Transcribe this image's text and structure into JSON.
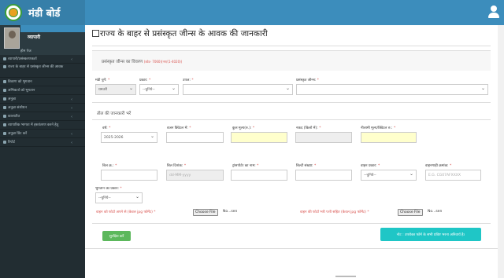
{
  "header": {
    "app_title": "मंडी बोर्ड"
  },
  "sidebar": {
    "user_name": "व्यापारी",
    "home_link": "होम पेज",
    "items": [
      {
        "label": "व्यापारी/प्रसंस्करणकर्ता"
      },
      {
        "label": "राज्य के बाहर से प्रसंस्कृत जीन्स की आवक"
      },
      {
        "label": "विवरण को भुगतान"
      },
      {
        "label": "अभिकर्ता को भुगतान"
      },
      {
        "label": "अनुज्ञा"
      },
      {
        "label": "अनुज्ञा संशोधन"
      },
      {
        "label": "कालातीत"
      },
      {
        "label": "व्यापारिक भागता में हस्तांतरण करने हेतु"
      },
      {
        "label": "अनुज्ञा प्रिंट करें"
      },
      {
        "label": "रिपोर्ट"
      }
    ]
  },
  "page": {
    "title": "राज्य के बाहर से प्रसंस्कृत जीन्स के आवक की जानकारी"
  },
  "panel": {
    "title": "प्रसंस्कृत जीन्स का विवरण",
    "hint": "(कोड- 7060)(नग/(1-4020))"
  },
  "row1": {
    "mandi_label": "मंडी चुनें:",
    "mandi_value": "धमतरी",
    "prakar_label": "प्रकार:",
    "prakar_value": "--चुनिये--",
    "upaj_label": "उपज:",
    "upaj_value": "",
    "jeans_label": "प्रसंस्कृत जीन्स:",
    "jeans_value": ""
  },
  "section": {
    "title": "तौल की जानकारी भरें"
  },
  "row2": {
    "year_label": "वर्ष:",
    "year_value": "2025-2026",
    "weight_label": "वजन क्विंटल में:",
    "price_label": "कुल मूल्य(रु.):",
    "cash_label": "नकद (किलो में):",
    "auction_label": "नीलामी मूल्य/क्विंटल रु.:"
  },
  "row3": {
    "bill_label": "बिल क्र.:",
    "bill_date_label": "बिल दिनांक:",
    "bill_date_placeholder": "dd-MM-yyyy",
    "transporter_label": "ट्रांसपोर्टर का नाम:",
    "builty_label": "बिल्टी संख्या:",
    "vehicle_type_label": "वाहन प्रकार:",
    "vehicle_type_value": "--चुनिये--",
    "vehicle_no_label": "वाहनगाड़ी क्रमांक:",
    "vehicle_no_placeholder": "E.G. CG07AFXXXX"
  },
  "row4": {
    "payment_label": "भुगतान का प्रकार:",
    "payment_value": "--चुनिये--"
  },
  "uploads": {
    "doc1_label": "वाहन को फोटो अपने से (केवल jpg फॉर्मेट)",
    "doc2_label": "वाहन की फोटो भरी पत्ती सहित (केवल jpg फॉर्मेट)",
    "choose_file": "Choose File",
    "no_file": "No...sen"
  },
  "actions": {
    "save_label": "सुरक्षित करें",
    "note": "नोट : उपरोक्त फॉर्म के सभी प्रविष्ट भरना अनिवार्य है।"
  },
  "colors": {
    "header": "#3c8dbc",
    "sidebar": "#222d32",
    "save": "#5cb85c",
    "note": "#1fc6c6"
  }
}
